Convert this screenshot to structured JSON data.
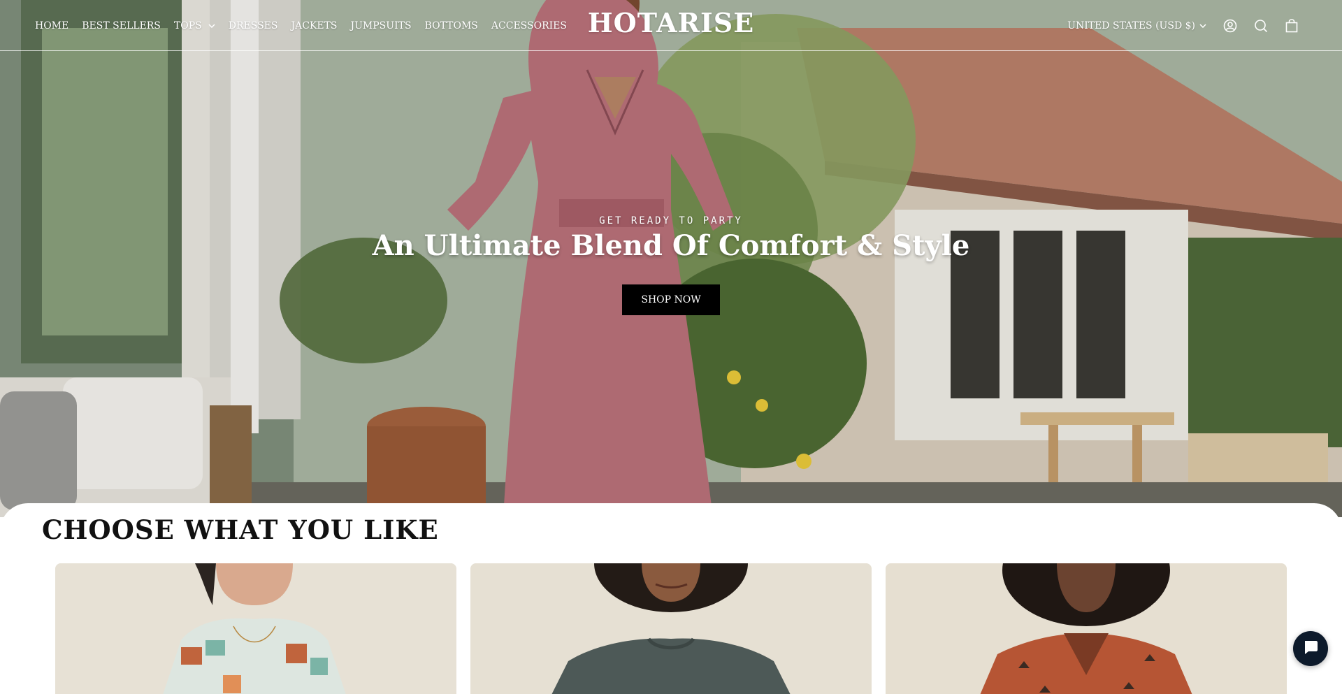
{
  "brand": {
    "logo_text": "HOTARISE"
  },
  "nav": {
    "items": [
      {
        "label": "HOME",
        "has_dropdown": false
      },
      {
        "label": "BEST SELLERS",
        "has_dropdown": false
      },
      {
        "label": "TOPS",
        "has_dropdown": true
      },
      {
        "label": "DRESSES",
        "has_dropdown": false
      },
      {
        "label": "JACKETS",
        "has_dropdown": false
      },
      {
        "label": "JUMPSUITS",
        "has_dropdown": false
      },
      {
        "label": "BOTTOMS",
        "has_dropdown": false
      },
      {
        "label": "ACCESSORIES",
        "has_dropdown": false
      }
    ]
  },
  "header_tools": {
    "currency_label": "UNITED STATES (USD $)",
    "icons": [
      "account-icon",
      "search-icon",
      "cart-icon"
    ]
  },
  "hero": {
    "eyebrow": "GET READY TO PARTY",
    "headline": "An Ultimate Blend Of Comfort & Style",
    "cta_label": "SHOP NOW"
  },
  "collection": {
    "title": "CHOOSE WHAT YOU LIKE",
    "cards": [
      {
        "image": "model-in-plaid-shirt"
      },
      {
        "image": "model-in-gray-sweatshirt"
      },
      {
        "image": "model-in-rust-printed-shirt"
      }
    ]
  },
  "chat": {
    "icon": "chat-bubble-icon"
  },
  "colors": {
    "header_text": "#ffffff",
    "cta_background": "#000000",
    "dress": "#b9717a",
    "chat_button": "#0d1a2b",
    "section_title": "#111111"
  }
}
